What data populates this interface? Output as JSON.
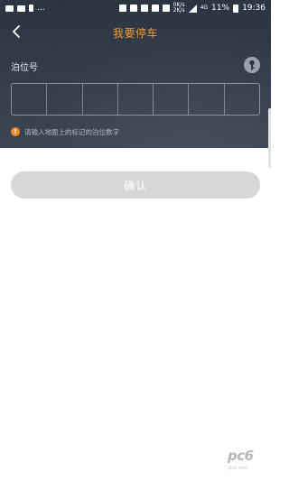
{
  "status_bar": {
    "left_text": "...",
    "battery_percent": "11%",
    "time": "19:36",
    "network_label": "4G",
    "speed_up": "0K/s",
    "speed_down": "2K/s"
  },
  "nav": {
    "title": "我要停车"
  },
  "form": {
    "label": "泊位号",
    "digit_slots": 7,
    "hint": "请输入地面上的标记的泊位数字"
  },
  "actions": {
    "confirm_label": "确认"
  },
  "watermark": {
    "main": "pc6",
    "sub": "pc6.com"
  },
  "colors": {
    "accent": "#f39d3b",
    "panel": "#343d4b",
    "warning": "#f08a2b",
    "disabled_button": "#d7d7d7"
  },
  "icons": {
    "back": "chevron-left-icon",
    "key": "key-icon",
    "warning": "warning-icon"
  }
}
